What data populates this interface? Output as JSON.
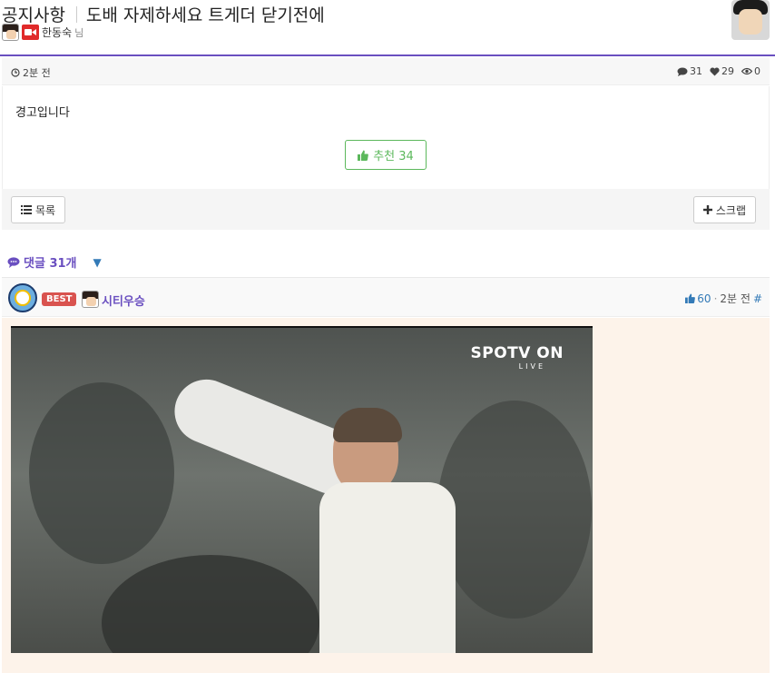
{
  "post": {
    "category": "공지사항",
    "title": "도배 자제하세요 트게더 닫기전에",
    "author": "한동숙",
    "author_suffix": "님",
    "time": "2분 전",
    "comments_count": "31",
    "likes_count": "29",
    "views_count": "0",
    "body": "경고입니다",
    "recommend_label": "추천 34"
  },
  "buttons": {
    "list_label": "목록",
    "scrap_label": "스크랩"
  },
  "comments": {
    "header": "댓글 31개",
    "toggle": "▼",
    "items": [
      {
        "badge": "BEST",
        "author": "시티우승",
        "likes": "60",
        "separator": "·",
        "time": "2분 전",
        "hash": "#",
        "media": {
          "watermark": "SPOTV ON",
          "sub": "LIVE"
        }
      }
    ]
  },
  "colors": {
    "accent": "#6a4fc0",
    "recommend": "#5cb85c",
    "best": "#d9534f",
    "link": "#337ab7",
    "comment_bg": "#fdf3ea"
  }
}
